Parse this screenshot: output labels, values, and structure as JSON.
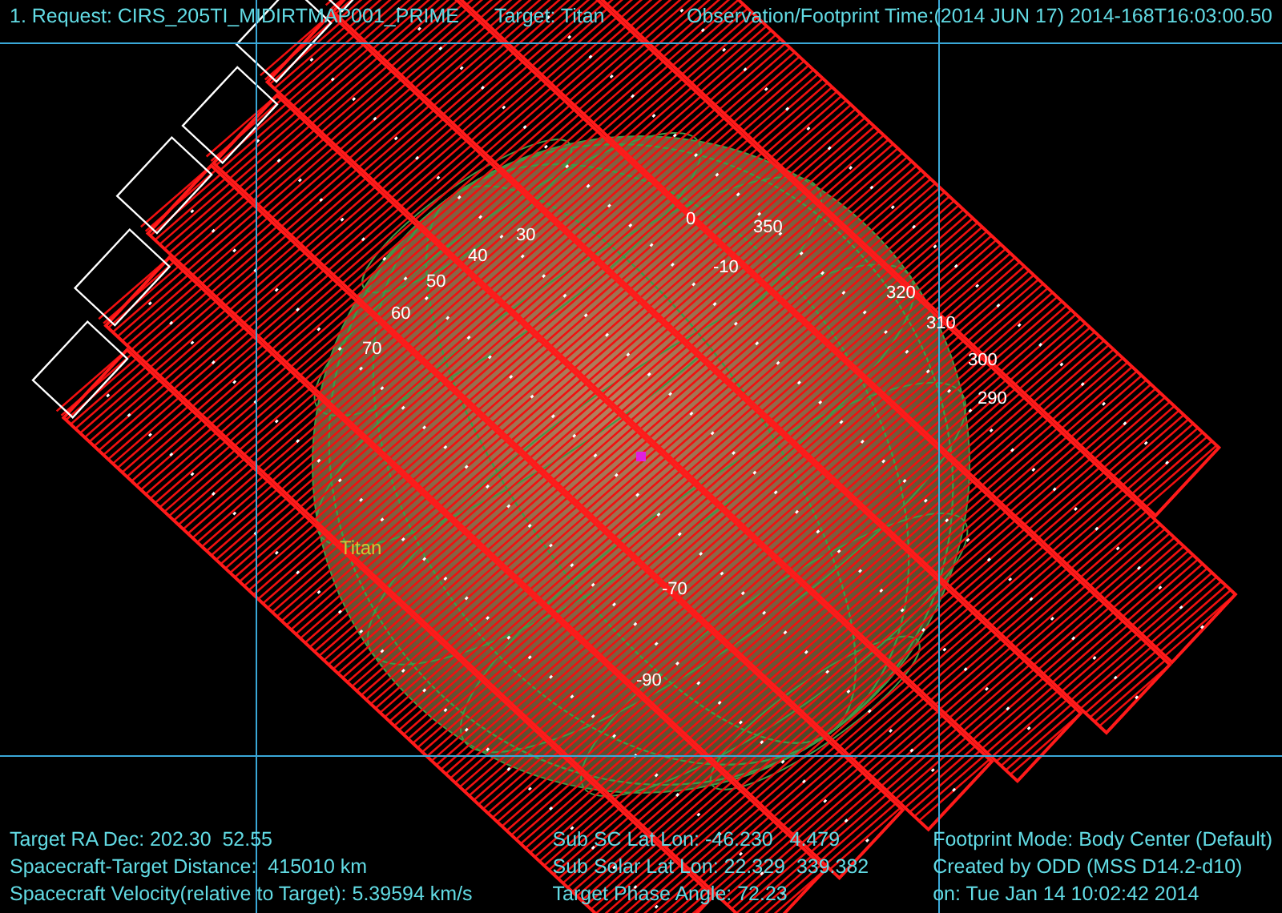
{
  "header": {
    "request": "1. Request: CIRS_205TI_MIDIRTMAP001_PRIME",
    "target": "Target: Titan",
    "time": "Observation/Footprint Time:(2014 JUN 17) 2014-168T16:03:00.50"
  },
  "plot": {
    "target_label": "Titan",
    "grid_labels": [
      "30",
      "40",
      "50",
      "60",
      "70",
      "0",
      "350",
      "-10",
      "320",
      "310",
      "300",
      "290",
      "-70",
      "-90"
    ]
  },
  "footer": {
    "left": [
      "Target RA Dec: 202.30  52.55",
      "Spacecraft-Target Distance:  415010 km",
      "Spacecraft Velocity(relative to Target): 5.39594 km/s"
    ],
    "middle": [
      "Sub SC Lat Lon: -46.230   4.479",
      "Sub Solar Lat Lon: 22.329  339.382",
      "Target Phase Angle: 72.23"
    ],
    "right": [
      "Footprint Mode: Body Center (Default)",
      "Created by ODD (MSS D14.2-d10)",
      "on: Tue Jan 14 10:02:42 2014"
    ]
  }
}
